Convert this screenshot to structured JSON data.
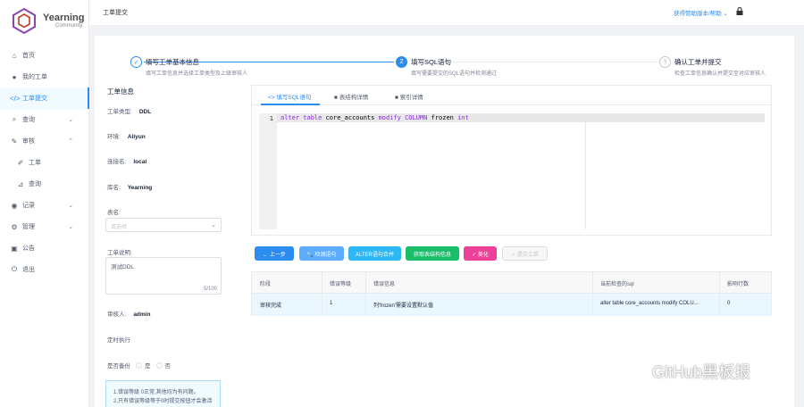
{
  "app": {
    "name": "Yearning",
    "sub": "Community",
    "brand_color": "#8e44ad",
    "accent": "#2d8cf0"
  },
  "header": {
    "title": "工单提交",
    "help": "获得赞助版本/帮助 ⌄"
  },
  "sidebar": {
    "items": [
      {
        "label": "首页",
        "icon": "home-icon"
      },
      {
        "label": "我的工单",
        "icon": "user-icon"
      },
      {
        "label": "工单提交",
        "icon": "code-icon"
      },
      {
        "label": "查询",
        "icon": "search-icon"
      },
      {
        "label": "审核",
        "icon": "edit-icon"
      },
      {
        "label": "工单",
        "icon": "pen-icon"
      },
      {
        "label": "查询",
        "icon": "rss-icon"
      },
      {
        "label": "记录",
        "icon": "record-icon"
      },
      {
        "label": "管理",
        "icon": "gear-icon"
      },
      {
        "label": "公告",
        "icon": "notice-icon"
      },
      {
        "label": "退出",
        "icon": "logout-icon"
      }
    ]
  },
  "steps": [
    {
      "num": "✓",
      "title": "填写工单基本信息",
      "desc": "填写工单信息并选择工单类型及上级审核人"
    },
    {
      "num": "2",
      "title": "填写SQL语句",
      "desc": "填写需要提交的SQL语句并检测通过"
    },
    {
      "num": "3",
      "title": "确认工单并提交",
      "desc": "检查工单信息确认并提交至对应审核人"
    }
  ],
  "info": {
    "title": "工单信息",
    "type_label": "工单类型:",
    "type_value": "DDL",
    "env_label": "环境:",
    "env_value": "Aliyun",
    "conn_label": "连接名:",
    "conn_value": "local",
    "db_label": "库名:",
    "db_value": "Yearning",
    "table_label": "表名:",
    "table_placeholder": "请选择",
    "desc_label": "工单说明:",
    "desc_value": "测试DDL",
    "desc_count": "5/100",
    "auditor_label": "审核人:",
    "auditor_value": "admin",
    "timer_label": "定时执行",
    "backup_label": "是否备份",
    "backup_yes": "是",
    "backup_no": "否",
    "tip_1": "1.错误等级 0正常,其他均为有问题。",
    "tip_2": "2.只有错误等级等于0时提交按钮才会激活"
  },
  "tabs": [
    {
      "label": "<> 填写SQL语句"
    },
    {
      "label": "表结构详情"
    },
    {
      "label": "索引详情"
    }
  ],
  "editor": {
    "line": "1",
    "code_kw1": "alter table",
    "code_ident": " core_accounts ",
    "code_kw2": "modify COLUMN",
    "code_ident2": " frozen ",
    "code_kw3": "int"
  },
  "buttons": [
    {
      "label": "← 上一步",
      "color": "#2d8cf0"
    },
    {
      "label": "🔍 检测语句",
      "color": "#5cadff"
    },
    {
      "label": "ALTER语句合并",
      "color": "#2db7f5"
    },
    {
      "label": "获取表结构信息",
      "color": "#19be6b"
    },
    {
      "label": "✓ 美化",
      "color": "#ed4099"
    },
    {
      "label": "✓ 提交工单",
      "color": "#ffffff"
    }
  ],
  "table": {
    "headers": [
      "阶段",
      "错误等级",
      "错误信息",
      "当前检查的sql",
      "影响行数"
    ],
    "rows": [
      [
        "审核完成",
        "1",
        "列'frozen'需要设置默认值",
        "alter table core_accounts modify COLU...",
        "0"
      ]
    ]
  },
  "watermark": "GitHub黑板报"
}
